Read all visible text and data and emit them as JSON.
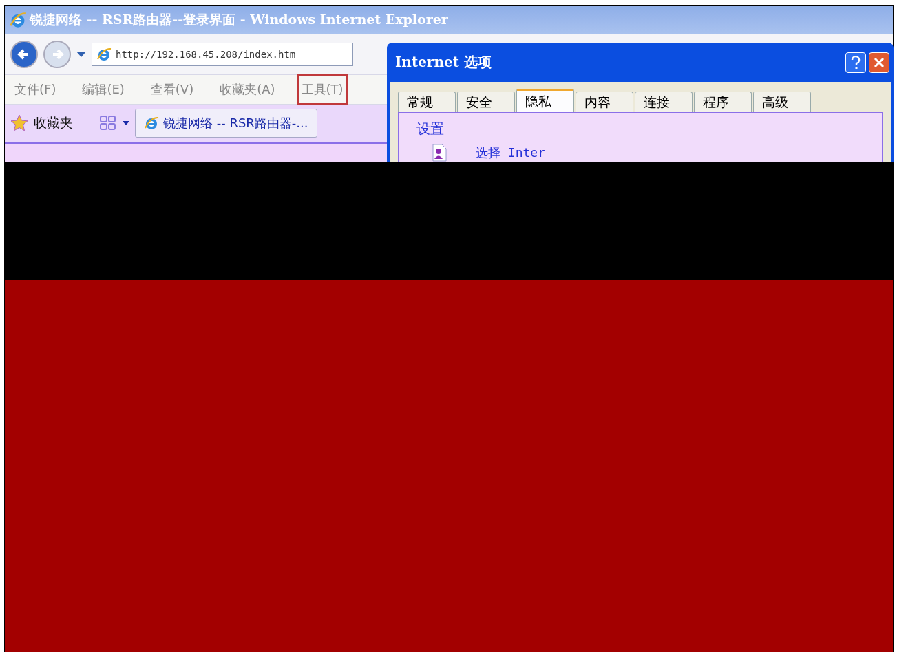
{
  "window": {
    "title": "锐捷网络 -- RSR路由器--登录界面 - Windows Internet Explorer"
  },
  "address_bar": {
    "url": "http://192.168.45.208/index.htm"
  },
  "menu": [
    {
      "label": "文件(F)",
      "highlighted": false
    },
    {
      "label": "编辑(E)",
      "highlighted": false
    },
    {
      "label": "查看(V)",
      "highlighted": false
    },
    {
      "label": "收藏夹(A)",
      "highlighted": false
    },
    {
      "label": "工具(T)",
      "highlighted": true
    }
  ],
  "favorites_bar": {
    "label": "收藏夹",
    "tab_title": "锐捷网络 -- RSR路由器-..."
  },
  "dialog": {
    "title": "Internet 选项",
    "tabs": [
      {
        "label": "常规",
        "selected": false
      },
      {
        "label": "安全",
        "selected": false
      },
      {
        "label": "隐私",
        "selected": true
      },
      {
        "label": "内容",
        "selected": false
      },
      {
        "label": "连接",
        "selected": false
      },
      {
        "label": "程序",
        "selected": false
      },
      {
        "label": "高级",
        "selected": false
      }
    ],
    "section": "设置",
    "option": "选择 Inter"
  }
}
